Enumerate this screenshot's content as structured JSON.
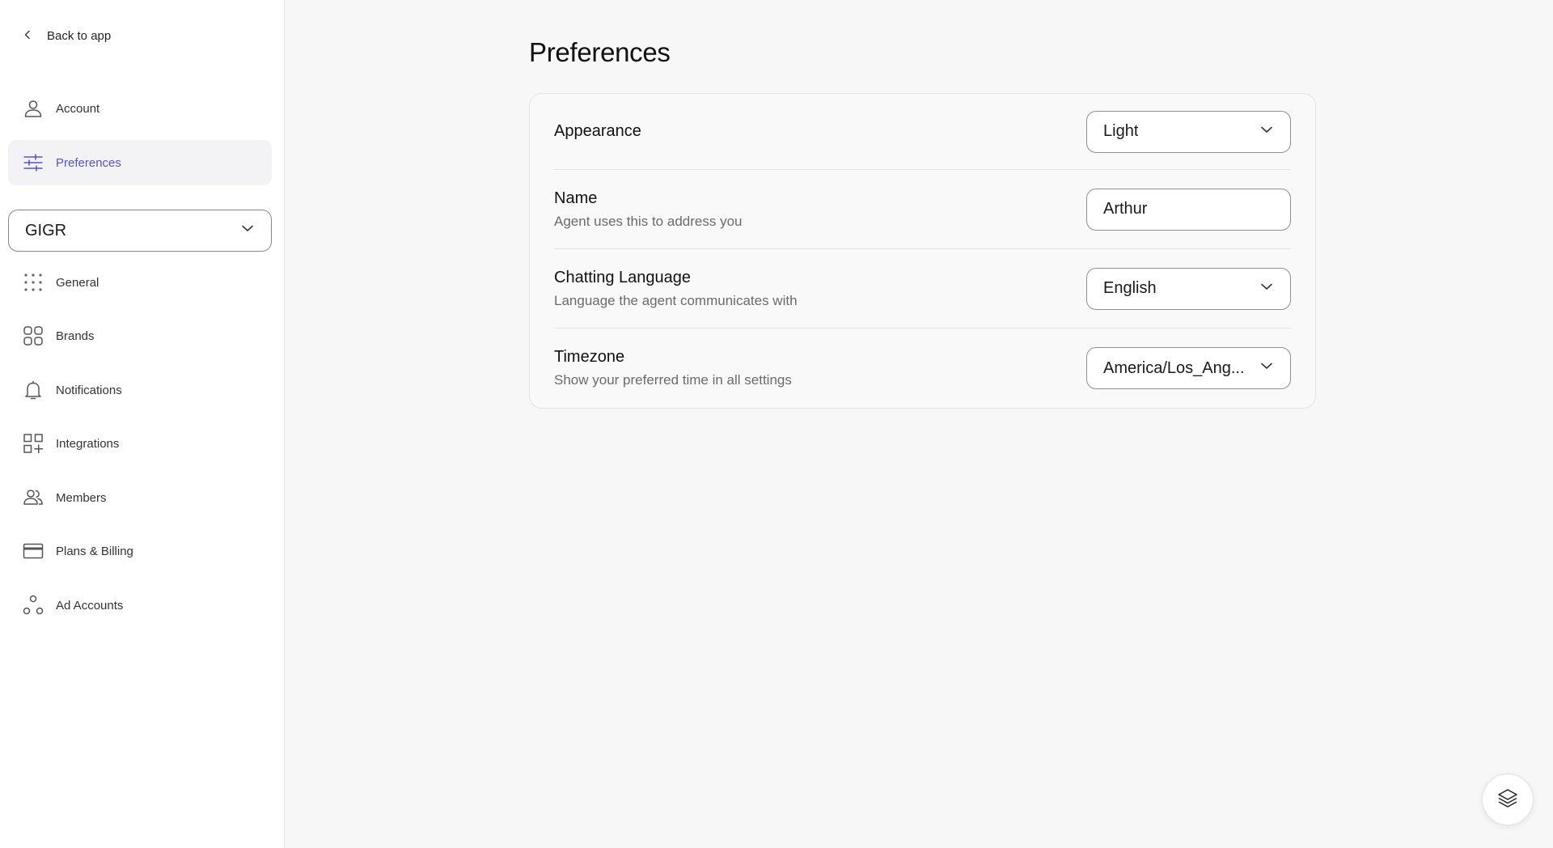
{
  "sidebar": {
    "back_label": "Back to app",
    "account_items": [
      {
        "label": "Account",
        "icon": "user-icon"
      },
      {
        "label": "Preferences",
        "icon": "sliders-icon",
        "active": true
      }
    ],
    "workspace": {
      "selected": "GIGR"
    },
    "workspace_items": [
      {
        "label": "General",
        "icon": "grid-dots-icon"
      },
      {
        "label": "Brands",
        "icon": "apps-icon"
      },
      {
        "label": "Notifications",
        "icon": "bell-icon"
      },
      {
        "label": "Integrations",
        "icon": "add-grid-icon"
      },
      {
        "label": "Members",
        "icon": "users-icon"
      },
      {
        "label": "Plans & Billing",
        "icon": "credit-card-icon"
      },
      {
        "label": "Ad Accounts",
        "icon": "nodes-icon"
      }
    ]
  },
  "main": {
    "title": "Preferences",
    "settings": [
      {
        "label": "Appearance",
        "description": "",
        "type": "select",
        "value": "Light"
      },
      {
        "label": "Name",
        "description": "Agent uses this to address you",
        "type": "input",
        "value": "Arthur"
      },
      {
        "label": "Chatting Language",
        "description": "Language the agent communicates with",
        "type": "select",
        "value": "English"
      },
      {
        "label": "Timezone",
        "description": "Show your preferred time in all settings",
        "type": "select",
        "value": "America/Los_Ang..."
      }
    ]
  },
  "fab": {
    "icon": "layers-icon"
  },
  "colors": {
    "accent": "#5553d6",
    "active_bg": "#f3f3f5",
    "page_bg": "#f7f7f7"
  }
}
